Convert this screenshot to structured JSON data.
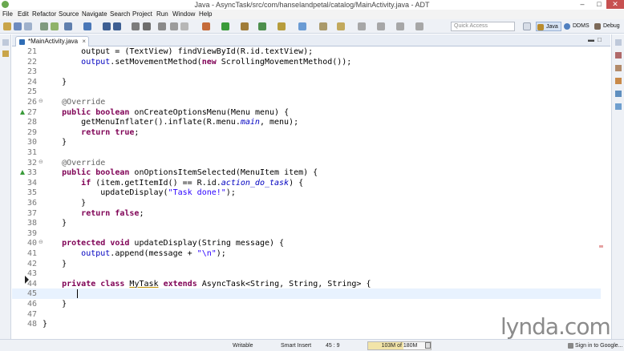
{
  "window": {
    "title": "Java - AsyncTask/src/com/hanselandpetal/catalog/MainActivity.java - ADT"
  },
  "menu": [
    "File",
    "Edit",
    "Refactor",
    "Source",
    "Navigate",
    "Search",
    "Project",
    "Run",
    "Window",
    "Help"
  ],
  "toolbar": {
    "quick_access_placeholder": "Quick Access",
    "perspectives": [
      "Java",
      "DDMS",
      "Debug"
    ]
  },
  "editor": {
    "tab_label": "*MainActivity.java",
    "tab_close": "×",
    "current_line": 45,
    "lines": [
      {
        "n": "21",
        "fold": "",
        "marker": "",
        "tokens": [
          {
            "t": "        output = (TextView) findViewById(R.id.textView);"
          }
        ]
      },
      {
        "n": "22",
        "fold": "",
        "marker": "",
        "tokens": [
          {
            "t": "        "
          },
          {
            "t": "output",
            "c": "field"
          },
          {
            "t": ".setMovementMethod("
          },
          {
            "t": "new",
            "c": "kw"
          },
          {
            "t": " ScrollingMovementMethod());"
          }
        ]
      },
      {
        "n": "23",
        "fold": "",
        "marker": "",
        "tokens": [
          {
            "t": ""
          }
        ]
      },
      {
        "n": "24",
        "fold": "",
        "marker": "",
        "tokens": [
          {
            "t": "    }"
          }
        ]
      },
      {
        "n": "25",
        "fold": "",
        "marker": "",
        "tokens": [
          {
            "t": ""
          }
        ]
      },
      {
        "n": "26",
        "fold": "⊖",
        "marker": "",
        "tokens": [
          {
            "t": "    "
          },
          {
            "t": "@Override",
            "c": "ann"
          }
        ]
      },
      {
        "n": "27",
        "fold": "",
        "marker": "override",
        "tokens": [
          {
            "t": "    "
          },
          {
            "t": "public",
            "c": "kw"
          },
          {
            "t": " "
          },
          {
            "t": "boolean",
            "c": "kw"
          },
          {
            "t": " onCreateOptionsMenu(Menu menu) {"
          }
        ]
      },
      {
        "n": "28",
        "fold": "",
        "marker": "",
        "tokens": [
          {
            "t": "        getMenuInflater().inflate(R.menu."
          },
          {
            "t": "main",
            "c": "ital"
          },
          {
            "t": ", menu);"
          }
        ]
      },
      {
        "n": "29",
        "fold": "",
        "marker": "",
        "tokens": [
          {
            "t": "        "
          },
          {
            "t": "return",
            "c": "kw"
          },
          {
            "t": " "
          },
          {
            "t": "true",
            "c": "kw"
          },
          {
            "t": ";"
          }
        ]
      },
      {
        "n": "30",
        "fold": "",
        "marker": "",
        "tokens": [
          {
            "t": "    }"
          }
        ]
      },
      {
        "n": "31",
        "fold": "",
        "marker": "",
        "tokens": [
          {
            "t": ""
          }
        ]
      },
      {
        "n": "32",
        "fold": "⊖",
        "marker": "",
        "tokens": [
          {
            "t": "    "
          },
          {
            "t": "@Override",
            "c": "ann"
          }
        ]
      },
      {
        "n": "33",
        "fold": "",
        "marker": "override",
        "tokens": [
          {
            "t": "    "
          },
          {
            "t": "public",
            "c": "kw"
          },
          {
            "t": " "
          },
          {
            "t": "boolean",
            "c": "kw"
          },
          {
            "t": " onOptionsItemSelected(MenuItem item) {"
          }
        ]
      },
      {
        "n": "34",
        "fold": "",
        "marker": "",
        "tokens": [
          {
            "t": "        "
          },
          {
            "t": "if",
            "c": "kw"
          },
          {
            "t": " (item.getItemId() == R.id."
          },
          {
            "t": "action_do_task",
            "c": "ital"
          },
          {
            "t": ") {"
          }
        ]
      },
      {
        "n": "35",
        "fold": "",
        "marker": "",
        "tokens": [
          {
            "t": "            updateDisplay("
          },
          {
            "t": "\"Task done!\"",
            "c": "str"
          },
          {
            "t": ");"
          }
        ]
      },
      {
        "n": "36",
        "fold": "",
        "marker": "",
        "tokens": [
          {
            "t": "        }"
          }
        ]
      },
      {
        "n": "37",
        "fold": "",
        "marker": "",
        "tokens": [
          {
            "t": "        "
          },
          {
            "t": "return",
            "c": "kw"
          },
          {
            "t": " "
          },
          {
            "t": "false",
            "c": "kw"
          },
          {
            "t": ";"
          }
        ]
      },
      {
        "n": "38",
        "fold": "",
        "marker": "",
        "tokens": [
          {
            "t": "    }"
          }
        ]
      },
      {
        "n": "39",
        "fold": "",
        "marker": "",
        "tokens": [
          {
            "t": ""
          }
        ]
      },
      {
        "n": "40",
        "fold": "⊖",
        "marker": "",
        "tokens": [
          {
            "t": "    "
          },
          {
            "t": "protected",
            "c": "kw"
          },
          {
            "t": " "
          },
          {
            "t": "void",
            "c": "kw"
          },
          {
            "t": " updateDisplay(String message) {"
          }
        ]
      },
      {
        "n": "41",
        "fold": "",
        "marker": "",
        "tokens": [
          {
            "t": "        "
          },
          {
            "t": "output",
            "c": "field"
          },
          {
            "t": ".append(message + "
          },
          {
            "t": "\"\\n\"",
            "c": "str"
          },
          {
            "t": ");"
          }
        ]
      },
      {
        "n": "42",
        "fold": "",
        "marker": "",
        "tokens": [
          {
            "t": "    }"
          }
        ]
      },
      {
        "n": "43",
        "fold": "",
        "marker": "",
        "tokens": [
          {
            "t": ""
          }
        ]
      },
      {
        "n": "44",
        "fold": "",
        "marker": "",
        "tokens": [
          {
            "t": "    "
          },
          {
            "t": "private",
            "c": "kw"
          },
          {
            "t": " "
          },
          {
            "t": "class",
            "c": "kw"
          },
          {
            "t": " "
          },
          {
            "t": "MyTask",
            "c": "udl"
          },
          {
            "t": " "
          },
          {
            "t": "extends",
            "c": "kw"
          },
          {
            "t": " AsyncTask<String, String, String> {"
          }
        ]
      },
      {
        "n": "45",
        "fold": "",
        "marker": "",
        "tokens": [
          {
            "t": ""
          }
        ]
      },
      {
        "n": "46",
        "fold": "",
        "marker": "",
        "tokens": [
          {
            "t": "    }"
          }
        ]
      },
      {
        "n": "47",
        "fold": "",
        "marker": "",
        "tokens": [
          {
            "t": ""
          }
        ]
      },
      {
        "n": "48",
        "fold": "",
        "marker": "",
        "tokens": [
          {
            "t": "}"
          }
        ]
      }
    ]
  },
  "status": {
    "mode": "Writable",
    "insert": "Smart Insert",
    "position": "45 : 9",
    "heap": "103M of 180M",
    "heap_fraction": 0.57,
    "signin": "Sign in to Google..."
  },
  "watermark": "lynda.com",
  "colors": {
    "keyword": "#7f0055",
    "annotation": "#646464",
    "field": "#0000c0",
    "string": "#2a00ff",
    "current_line": "#e8f2fe",
    "override_marker": "#3a9b3a"
  }
}
